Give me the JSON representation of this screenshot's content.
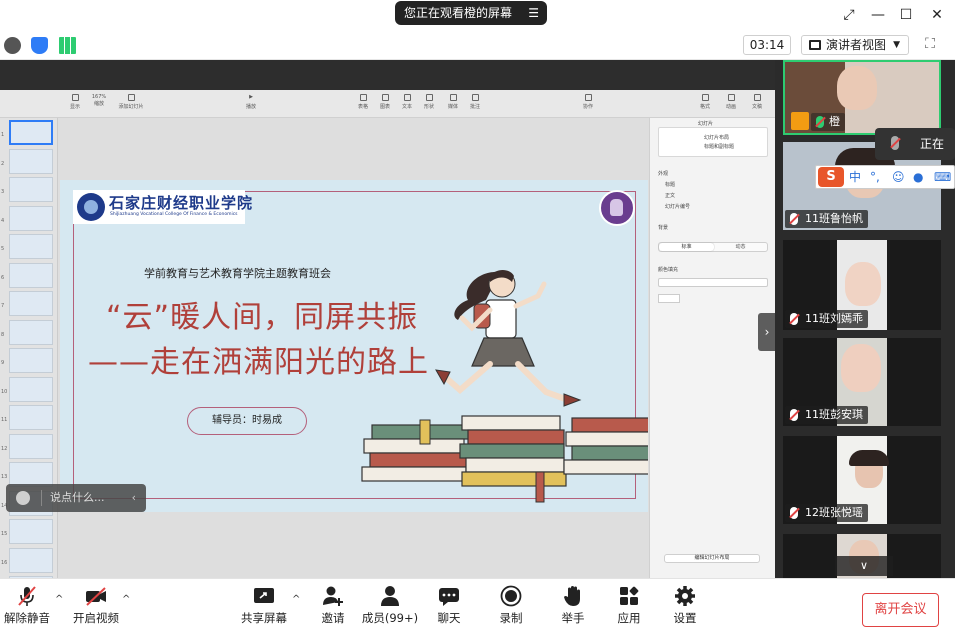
{
  "window": {
    "share_banner": "您正在观看橙的屏幕",
    "banner_menu_icon": "menu-icon"
  },
  "toolbar": {
    "timer": "03:14",
    "view_mode": "演讲者视图",
    "icons": [
      "info-icon",
      "shield-icon",
      "signal-icon"
    ],
    "colors": {
      "info": "#555555",
      "shield": "#2e7cf6",
      "signal": "#2ecc71"
    }
  },
  "slide": {
    "logo_cn": "石家庄财经职业学院",
    "logo_en": "ShiJiazhuang Vocational College Of Finance & Economics",
    "subtitle": "学前教育与艺术教育学院主题教育班会",
    "headline_line1": "“云”暖人间，同屏共振",
    "headline_line2": "——走在洒满阳光的路上",
    "advisor": "辅导员：时易成",
    "colors": {
      "background": "#d6e8f1",
      "headline": "#b0403a",
      "frame": "#b4607b"
    }
  },
  "keynote": {
    "zoom": "167%",
    "toolbar_tools": [
      "显示",
      "缩放",
      "添加幻灯片",
      "播放",
      "表格",
      "图表",
      "文本",
      "形状",
      "媒体",
      "批注",
      "协作",
      "格式",
      "动画",
      "文稿"
    ],
    "inspector_tab": "幻灯片",
    "layout_title": "幻灯片布局",
    "layout_name": "标题和副标题",
    "appearance_label": "外观",
    "appearance_options": [
      "标题",
      "正文",
      "幻灯片编号"
    ],
    "background_label": "背景",
    "background_tabs": [
      "标准",
      "动态"
    ],
    "fill_label": "颜色填充",
    "edit_layout_button": "编辑幻灯片布局",
    "thumb_count": 19
  },
  "chat_hint": {
    "placeholder": "说点什么...",
    "icon": "smile-icon"
  },
  "gallery": {
    "speaking_label": "正在讲",
    "participants": [
      {
        "name": "橙",
        "active": true,
        "host": true
      },
      {
        "name": "11班鲁怡帆"
      },
      {
        "name": "11班刘嫣乖"
      },
      {
        "name": "11班彭安琪"
      },
      {
        "name": "12班张悦瑶"
      },
      {
        "name": ""
      }
    ],
    "ime_logo": "S",
    "ime_mode": "中"
  },
  "bottom_bar": {
    "items": [
      {
        "label": "解除静音",
        "icon": "mic-muted-icon"
      },
      {
        "label": "开启视频",
        "icon": "video-off-icon"
      },
      {
        "label": "共享屏幕",
        "icon": "share-screen-icon"
      },
      {
        "label": "邀请",
        "icon": "invite-icon"
      },
      {
        "label": "成员(99+)",
        "icon": "members-icon"
      },
      {
        "label": "聊天",
        "icon": "chat-icon"
      },
      {
        "label": "录制",
        "icon": "record-icon"
      },
      {
        "label": "举手",
        "icon": "raise-hand-icon"
      },
      {
        "label": "应用",
        "icon": "apps-icon"
      },
      {
        "label": "设置",
        "icon": "settings-icon"
      }
    ],
    "leave_label": "离开会议",
    "leave_color": "#e04343"
  }
}
